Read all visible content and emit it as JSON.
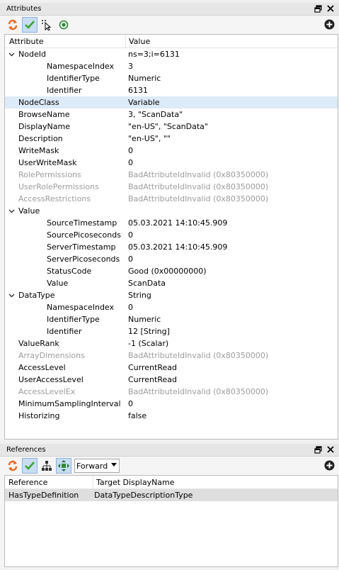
{
  "attributes_panel": {
    "title": "Attributes",
    "columns": {
      "attribute": "Attribute",
      "value": "Value"
    },
    "rows": [
      {
        "level": 0,
        "expandable": true,
        "label": "NodeId",
        "value": "ns=3;i=6131",
        "disabled": false,
        "selected": false
      },
      {
        "level": 1,
        "expandable": false,
        "label": "NamespaceIndex",
        "value": "3",
        "disabled": false,
        "selected": false
      },
      {
        "level": 1,
        "expandable": false,
        "label": "IdentifierType",
        "value": "Numeric",
        "disabled": false,
        "selected": false
      },
      {
        "level": 1,
        "expandable": false,
        "label": "Identifier",
        "value": "6131",
        "disabled": false,
        "selected": false
      },
      {
        "level": 0,
        "expandable": false,
        "label": "NodeClass",
        "value": "Variable",
        "disabled": false,
        "selected": true
      },
      {
        "level": 0,
        "expandable": false,
        "label": "BrowseName",
        "value": "3, \"ScanData\"",
        "disabled": false,
        "selected": false
      },
      {
        "level": 0,
        "expandable": false,
        "label": "DisplayName",
        "value": "\"en-US\", \"ScanData\"",
        "disabled": false,
        "selected": false
      },
      {
        "level": 0,
        "expandable": false,
        "label": "Description",
        "value": "\"en-US\", \"\"",
        "disabled": false,
        "selected": false
      },
      {
        "level": 0,
        "expandable": false,
        "label": "WriteMask",
        "value": "0",
        "disabled": false,
        "selected": false
      },
      {
        "level": 0,
        "expandable": false,
        "label": "UserWriteMask",
        "value": "0",
        "disabled": false,
        "selected": false
      },
      {
        "level": 0,
        "expandable": false,
        "label": "RolePermissions",
        "value": "BadAttributeIdInvalid (0x80350000)",
        "disabled": true,
        "selected": false
      },
      {
        "level": 0,
        "expandable": false,
        "label": "UserRolePermissions",
        "value": "BadAttributeIdInvalid (0x80350000)",
        "disabled": true,
        "selected": false
      },
      {
        "level": 0,
        "expandable": false,
        "label": "AccessRestrictions",
        "value": "BadAttributeIdInvalid (0x80350000)",
        "disabled": true,
        "selected": false
      },
      {
        "level": 0,
        "expandable": true,
        "label": "Value",
        "value": "",
        "disabled": false,
        "selected": false
      },
      {
        "level": 1,
        "expandable": false,
        "label": "SourceTimestamp",
        "value": "05.03.2021 14:10:45.909",
        "disabled": false,
        "selected": false
      },
      {
        "level": 1,
        "expandable": false,
        "label": "SourcePicoseconds",
        "value": "0",
        "disabled": false,
        "selected": false
      },
      {
        "level": 1,
        "expandable": false,
        "label": "ServerTimestamp",
        "value": "05.03.2021 14:10:45.909",
        "disabled": false,
        "selected": false
      },
      {
        "level": 1,
        "expandable": false,
        "label": "ServerPicoseconds",
        "value": "0",
        "disabled": false,
        "selected": false
      },
      {
        "level": 1,
        "expandable": false,
        "label": "StatusCode",
        "value": "Good (0x00000000)",
        "disabled": false,
        "selected": false
      },
      {
        "level": 1,
        "expandable": false,
        "label": "Value",
        "value": "ScanData",
        "disabled": false,
        "selected": false
      },
      {
        "level": 0,
        "expandable": true,
        "label": "DataType",
        "value": "String",
        "disabled": false,
        "selected": false
      },
      {
        "level": 1,
        "expandable": false,
        "label": "NamespaceIndex",
        "value": "0",
        "disabled": false,
        "selected": false
      },
      {
        "level": 1,
        "expandable": false,
        "label": "IdentifierType",
        "value": "Numeric",
        "disabled": false,
        "selected": false
      },
      {
        "level": 1,
        "expandable": false,
        "label": "Identifier",
        "value": "12 [String]",
        "disabled": false,
        "selected": false
      },
      {
        "level": 0,
        "expandable": false,
        "label": "ValueRank",
        "value": "-1 (Scalar)",
        "disabled": false,
        "selected": false
      },
      {
        "level": 0,
        "expandable": false,
        "label": "ArrayDimensions",
        "value": "BadAttributeIdInvalid (0x80350000)",
        "disabled": true,
        "selected": false
      },
      {
        "level": 0,
        "expandable": false,
        "label": "AccessLevel",
        "value": "CurrentRead",
        "disabled": false,
        "selected": false
      },
      {
        "level": 0,
        "expandable": false,
        "label": "UserAccessLevel",
        "value": "CurrentRead",
        "disabled": false,
        "selected": false
      },
      {
        "level": 0,
        "expandable": false,
        "label": "AccessLevelEx",
        "value": "BadAttributeIdInvalid (0x80350000)",
        "disabled": true,
        "selected": false
      },
      {
        "level": 0,
        "expandable": false,
        "label": "MinimumSamplingInterval",
        "value": "0",
        "disabled": false,
        "selected": false
      },
      {
        "level": 0,
        "expandable": false,
        "label": "Historizing",
        "value": "false",
        "disabled": false,
        "selected": false
      }
    ]
  },
  "references_panel": {
    "title": "References",
    "direction_selected": "Forward",
    "columns": {
      "reference": "Reference",
      "target": "Target DisplayName"
    },
    "rows": [
      {
        "reference": "HasTypeDefinition",
        "target": "DataTypeDescriptionType"
      }
    ]
  },
  "colors": {
    "refresh_orange": "#e8641e",
    "check_green": "#3aa332",
    "watch_green": "#2e8b3a",
    "disabled_text": "#9c9c9c",
    "selected_row": "#ddeaf7",
    "toolbar_active": "#c8ddf2"
  },
  "icons": {
    "refresh": "refresh-icon",
    "check": "check-icon",
    "cursor": "select-pointer-icon",
    "watch": "watch-icon",
    "hierarchy": "hierarchy-icon",
    "move": "move-arrows-icon",
    "add": "add-circle-icon",
    "float": "float-window-icon",
    "close": "close-icon"
  }
}
